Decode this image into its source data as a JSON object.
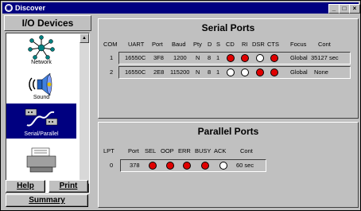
{
  "window": {
    "title": "Discover",
    "title_icon": "app-icon"
  },
  "left": {
    "heading": "I/O Devices",
    "items": [
      {
        "label": "Network",
        "icon": "network-icon"
      },
      {
        "label": "Sound",
        "icon": "speaker-icon"
      },
      {
        "label": "Serial/Parallel",
        "icon": "cable-icon"
      },
      {
        "label": "",
        "icon": "printer-icon"
      }
    ],
    "buttons": {
      "help": "Help",
      "print": "Print",
      "summary": "Summary"
    }
  },
  "serial": {
    "title": "Serial Ports",
    "headers": [
      "COM",
      "UART",
      "Port",
      "Baud",
      "Pty",
      "D",
      "S",
      "CD",
      "RI",
      "DSR",
      "CTS",
      "Focus",
      "Cont"
    ],
    "rows": [
      {
        "com": "1",
        "uart": "16550C",
        "port": "3F8",
        "baud": "1200",
        "pty": "N",
        "d": "8",
        "s": "1",
        "cd": "on",
        "ri": "on",
        "dsr": "off",
        "cts": "on",
        "focus": "Global",
        "cont": "35127 sec"
      },
      {
        "com": "2",
        "uart": "16550C",
        "port": "2E8",
        "baud": "115200",
        "pty": "N",
        "d": "8",
        "s": "1",
        "cd": "off",
        "ri": "off",
        "dsr": "on",
        "cts": "on",
        "focus": "Global",
        "cont": "None"
      }
    ]
  },
  "parallel": {
    "title": "Parallel Ports",
    "headers": [
      "LPT",
      "Port",
      "SEL",
      "OOP",
      "ERR",
      "BUSY",
      "ACK",
      "Cont"
    ],
    "rows": [
      {
        "lpt": "0",
        "port": "378",
        "sel": "on",
        "oop": "on",
        "err": "on",
        "busy": "on",
        "ack": "off",
        "cont": "60 sec"
      }
    ]
  },
  "colors": {
    "led_on": "#e00000",
    "led_off": "#ffffff",
    "title_bar": "#000080",
    "selection": "#000080"
  }
}
